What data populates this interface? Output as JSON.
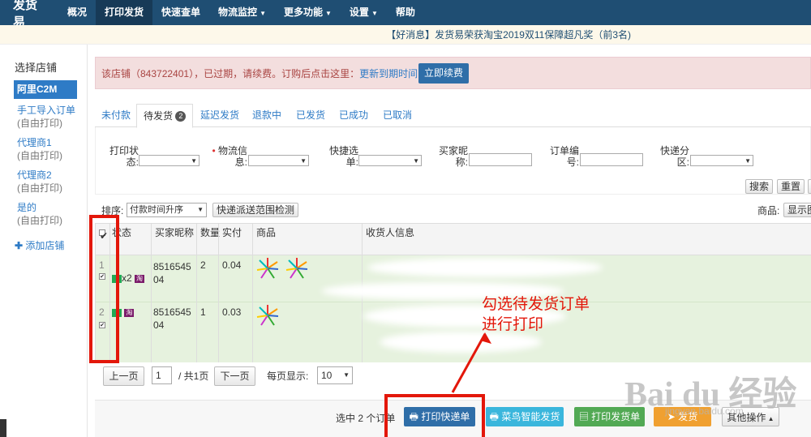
{
  "nav": {
    "brand": "发货易",
    "items": [
      {
        "label": "概况",
        "caret": false
      },
      {
        "label": "打印发货",
        "caret": false,
        "active": true
      },
      {
        "label": "快速查单",
        "caret": false
      },
      {
        "label": "物流监控",
        "caret": true
      },
      {
        "label": "更多功能",
        "caret": true
      },
      {
        "label": "设置",
        "caret": true
      },
      {
        "label": "帮助",
        "caret": false
      }
    ]
  },
  "notice": "【好消息】发货易荣获淘宝2019双11保障超凡奖（前3名)",
  "sidebar": {
    "title": "选择店铺",
    "active_shop": "阿里C2M",
    "items": [
      {
        "label": "手工导入订单",
        "sub": "(自由打印)"
      },
      {
        "label": "代理商1",
        "sub": "(自由打印)"
      },
      {
        "label": "代理商2",
        "sub": "(自由打印)"
      },
      {
        "label": "是的",
        "sub": "(自由打印)"
      }
    ],
    "add_label": "添加店铺"
  },
  "alert": {
    "text": "该店铺（843722401），已过期，请续费。订购后点击这里：",
    "link": "更新到期时间",
    "button": "立即续费"
  },
  "tabs": [
    {
      "label": "未付款"
    },
    {
      "label": "待发货",
      "badge": "2",
      "active": true
    },
    {
      "label": "延迟发货"
    },
    {
      "label": "退款中"
    },
    {
      "label": "已发货"
    },
    {
      "label": "已成功"
    },
    {
      "label": "已取消"
    }
  ],
  "filters": {
    "print_status": "打印状态:",
    "logistics": "物流信息:",
    "express": "快捷选单:",
    "buyer_nick": "买家昵称:",
    "order_no": "订单编号:",
    "express_zone": "快递分区:",
    "search": "搜索",
    "reset": "重置"
  },
  "toolbar": {
    "sort_label": "排序:",
    "sort_value": "付款时间升序",
    "check_range": "快递派送范围检测",
    "goods_label": "商品:",
    "goods_value": "显示图"
  },
  "table": {
    "headers": {
      "status": "状态",
      "buyer": "买家昵称",
      "qty": "数量",
      "paid": "实付",
      "goods": "商品",
      "receiver": "收货人信息"
    },
    "rows": [
      {
        "index": "1",
        "buyer": "8516545 04",
        "qty": "2",
        "paid": "0.04",
        "status_extra": "x2",
        "flag": "淘"
      },
      {
        "index": "2",
        "buyer": "8516545 04",
        "qty": "1",
        "paid": "0.03",
        "flag": "淘"
      }
    ]
  },
  "pager": {
    "prev": "上一页",
    "page": "1",
    "total": "/ 共1页",
    "next": "下一页",
    "per_page_label": "每页显示:",
    "per_page": "10"
  },
  "bottom": {
    "selected": "选中 2 个订单",
    "print_express": "打印快递单",
    "cainiao": "菜鸟智能发货",
    "print_invoice": "打印发货单",
    "ship": "发货",
    "other": "其他操作"
  },
  "annotation": {
    "line1": "勾选待发货订单",
    "line2": "进行打印"
  },
  "watermark": {
    "logo": "Bai du 经验",
    "url": "jingyan.baidu.com"
  },
  "colors": {
    "nav": "#1f4e73",
    "accent": "#2e7bc6",
    "row_green": "#e6f2de",
    "annotation_red": "#e3170a"
  }
}
